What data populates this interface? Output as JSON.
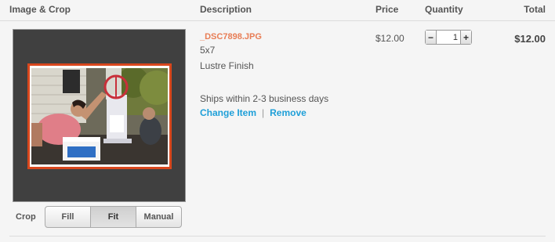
{
  "columns": {
    "image_crop": "Image & Crop",
    "description": "Description",
    "price": "Price",
    "quantity": "Quantity",
    "total": "Total"
  },
  "item": {
    "filename": "_DSC7898.JPG",
    "size": "5x7",
    "finish": "Lustre Finish",
    "shipping": "Ships within 2-3 business days",
    "change_label": "Change Item",
    "separator": "|",
    "remove_label": "Remove",
    "price": "$12.00",
    "quantity": "1",
    "total": "$12.00"
  },
  "crop": {
    "label": "Crop",
    "options": [
      "Fill",
      "Fit",
      "Manual"
    ],
    "selected": "Fit"
  },
  "qty_controls": {
    "minus": "−",
    "plus": "+"
  },
  "colors": {
    "filename": "#e87d55",
    "link": "#1e9fd8",
    "crop_frame": "#d8471d",
    "panel_bg": "#404040"
  }
}
